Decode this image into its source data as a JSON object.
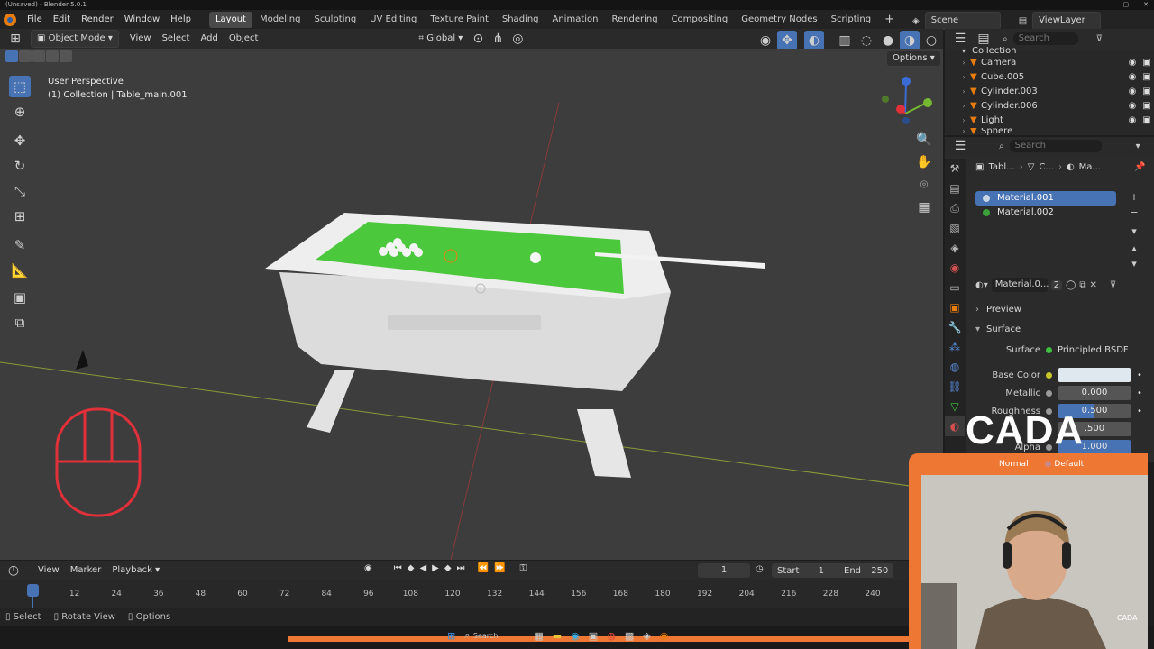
{
  "window": {
    "title": "(Unsaved) - Blender 5.0.1"
  },
  "menu": {
    "file": "File",
    "edit": "Edit",
    "render": "Render",
    "window": "Window",
    "help": "Help"
  },
  "workspaces": [
    "Layout",
    "Modeling",
    "Sculpting",
    "UV Editing",
    "Texture Paint",
    "Shading",
    "Animation",
    "Rendering",
    "Compositing",
    "Geometry Nodes",
    "Scripting"
  ],
  "scene": {
    "label": "Scene",
    "viewlayer": "ViewLayer"
  },
  "viewport_header": {
    "mode": "Object Mode",
    "view": "View",
    "select": "Select",
    "add": "Add",
    "object": "Object",
    "orientation": "Global"
  },
  "viewport": {
    "perspective": "User Perspective",
    "collection_line": "(1) Collection | Table_main.001",
    "options": "Options"
  },
  "outliner": {
    "search_placeholder": "Search",
    "collection": "Collection",
    "items": [
      "Camera",
      "Cube.005",
      "Cylinder.003",
      "Cylinder.006",
      "Light",
      "Sphere"
    ]
  },
  "properties": {
    "search_placeholder": "Search",
    "breadcrumb": [
      "Tabl...",
      "C...",
      "Ma..."
    ],
    "slots": [
      {
        "name": "Material.001",
        "color": "#c9d6e6"
      },
      {
        "name": "Material.002",
        "color": "#3aa13a"
      }
    ],
    "material_name": "Material.0...",
    "users": "2",
    "preview": "Preview",
    "surface_section": "Surface",
    "surface_label": "Surface",
    "surface_value": "Principled BSDF",
    "base_color_label": "Base Color",
    "metallic_label": "Metallic",
    "metallic_value": "0.000",
    "roughness_label": "Roughness",
    "roughness_value": "0.500",
    "ior_value": ".500",
    "alpha_label": "Alpha",
    "alpha_value": "1.000",
    "normal_label": "Normal",
    "normal_value": "Default"
  },
  "timeline": {
    "view": "View",
    "marker": "Marker",
    "playback": "Playback",
    "current_frame": "1",
    "start_label": "Start",
    "start": "1",
    "end_label": "End",
    "end": "250",
    "ticks": [
      "1",
      "12",
      "24",
      "36",
      "48",
      "60",
      "72",
      "84",
      "96",
      "108",
      "120",
      "132",
      "144",
      "156",
      "168",
      "180",
      "192",
      "204",
      "216",
      "228",
      "240"
    ]
  },
  "statusbar": {
    "select": "Select",
    "rotate": "Rotate View",
    "options": "Options"
  },
  "taskbar": {
    "search": "Search"
  },
  "overlay": {
    "brand": "CADA",
    "watermark": "CADA"
  },
  "colors": {
    "accent": "#4772b3",
    "orange": "#e87d0d",
    "felt": "#4cc83d",
    "mouse_overlay": "#e0303a",
    "webcam_frame": "#ee7733"
  }
}
